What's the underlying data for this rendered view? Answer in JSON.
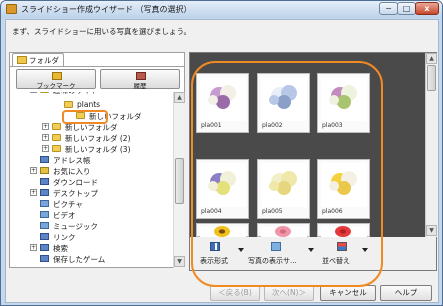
{
  "window": {
    "title": "スライドショー作成ウイザード （写真の選択）",
    "controls": {
      "minimize": "−",
      "maximize": "□",
      "close": "x"
    }
  },
  "instruction": "まず、スライドショーに用いる写真を選びましょう。",
  "left_panel": {
    "tab_label": "フォルダ",
    "bookmark_button": "ブックマーク",
    "history_button": "履歴",
    "tree": [
      {
        "label": "趣味のサイト",
        "icon": "folder-icon",
        "expander": "−"
      },
      {
        "label": "plants",
        "icon": "folder-icon",
        "selected": true
      },
      {
        "label": "新しいフォルダ",
        "icon": "folder-icon"
      },
      {
        "label": "新しいフォルダ",
        "icon": "folder-icon",
        "expander": "+"
      },
      {
        "label": "新しいフォルダ (2)",
        "icon": "folder-icon",
        "expander": "+"
      },
      {
        "label": "新しいフォルダ (3)",
        "icon": "folder-icon",
        "expander": "+"
      },
      {
        "label": "アドレス帳",
        "icon": "contacts-icon"
      },
      {
        "label": "お気に入り",
        "icon": "favorites-icon",
        "expander": "+"
      },
      {
        "label": "ダウンロード",
        "icon": "downloads-icon"
      },
      {
        "label": "デスクトップ",
        "icon": "desktop-icon",
        "expander": "+"
      },
      {
        "label": "ピクチャ",
        "icon": "pictures-icon"
      },
      {
        "label": "ビデオ",
        "icon": "video-icon"
      },
      {
        "label": "ミュージック",
        "icon": "music-icon"
      },
      {
        "label": "リンク",
        "icon": "links-icon"
      },
      {
        "label": "検索",
        "icon": "search-icon",
        "expander": "+"
      },
      {
        "label": "保存したゲーム",
        "icon": "saved-games-icon"
      }
    ]
  },
  "thumbnails": [
    {
      "caption": "pla001",
      "flower": "mixed-bouquet",
      "colors": [
        "#c79ad2",
        "#f3f0e8",
        "#9b6aa8"
      ]
    },
    {
      "caption": "pla002",
      "flower": "mixed-bouquet",
      "colors": [
        "#e8eef8",
        "#b7c7e8",
        "#8aa0c8"
      ]
    },
    {
      "caption": "pla003",
      "flower": "mixed-bouquet",
      "colors": [
        "#c48bbf",
        "#eef3df",
        "#a9c46f"
      ]
    },
    {
      "caption": "pla004",
      "flower": "mixed-bouquet",
      "colors": [
        "#8d7fc7",
        "#f2f0d8",
        "#e4e07a"
      ]
    },
    {
      "caption": "pla005",
      "flower": "mixed-bouquet",
      "colors": [
        "#f3efc9",
        "#efe8a9",
        "#e6d77f"
      ]
    },
    {
      "caption": "pla006",
      "flower": "mixed-bouquet",
      "colors": [
        "#f5d13d",
        "#f4f1e4",
        "#e9c84b"
      ]
    },
    {
      "caption": "",
      "flower": "sunflower",
      "colors": [
        "#f2c21c",
        "#7a4a10",
        "#4f8b3a"
      ]
    },
    {
      "caption": "",
      "flower": "cyclamen",
      "colors": [
        "#ef97a8",
        "#d86b83",
        "#4f8b3a"
      ]
    },
    {
      "caption": "",
      "flower": "rose",
      "colors": [
        "#e23a3a",
        "#b81f24",
        "#4f8b3a"
      ]
    }
  ],
  "toolbar": {
    "display_format": "表示形式",
    "photo_display": "写真の表示サ...",
    "sort": "並べ替え"
  },
  "buttons": {
    "back": "＜戻る(B)",
    "next": "次へ(N)＞",
    "cancel": "キャンセル",
    "help": "ヘルプ"
  },
  "colors": {
    "highlight": "#f08a24",
    "window_frame": "#c4d7ec",
    "thumbnail_background": "#4a4a4a"
  }
}
